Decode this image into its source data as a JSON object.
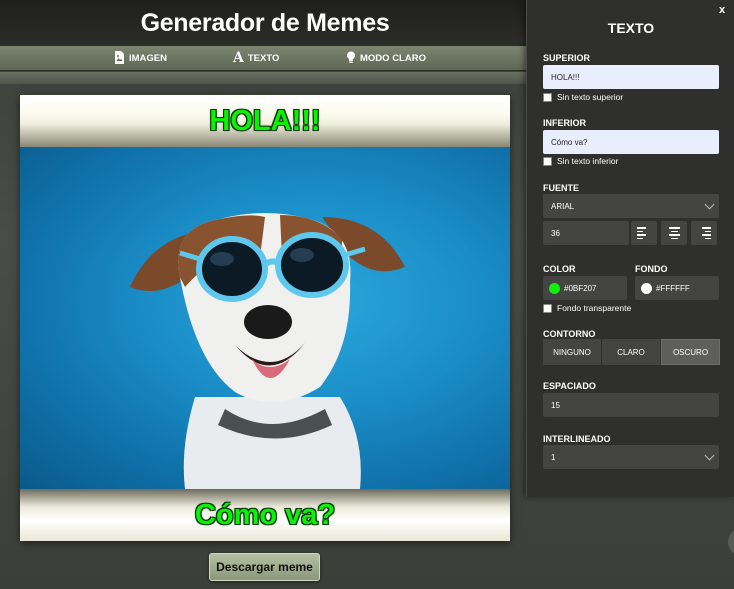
{
  "app": {
    "title": "Generador de Memes"
  },
  "nav": {
    "imagen": {
      "label": "IMAGEN",
      "icon": "image-file-icon"
    },
    "texto": {
      "label": "TEXTO",
      "icon": "text-a-icon"
    },
    "modo": {
      "label": "MODO CLARO",
      "icon": "lightbulb-icon"
    }
  },
  "meme": {
    "top_text": "HOLA!!!",
    "bottom_text": "Cómo va?",
    "text_color": "#0BF207",
    "download_label": "Descargar meme"
  },
  "panel": {
    "title": "TEXTO",
    "close_label": "x",
    "superior": {
      "label": "SUPERIOR",
      "value": "HOLA!!!",
      "checkbox_label": "Sin texto superior"
    },
    "inferior": {
      "label": "INFERIOR",
      "value": "Cómo va?",
      "checkbox_label": "Sin texto inferior"
    },
    "fuente": {
      "label": "FUENTE",
      "value": "ARIAL",
      "size": "36"
    },
    "color": {
      "label": "COLOR",
      "value": "#0BF207",
      "swatch": "#0BF207"
    },
    "fondo": {
      "label": "FONDO",
      "value": "#FFFFFF",
      "swatch": "#FFFFFF",
      "transparent_label": "Fondo transparente"
    },
    "contorno": {
      "label": "CONTORNO",
      "options": [
        "NINGUNO",
        "CLARO",
        "OSCURO"
      ],
      "selected": "OSCURO"
    },
    "espaciado": {
      "label": "ESPACIADO",
      "value": "15"
    },
    "interlineado": {
      "label": "INTERLINEADO",
      "value": "1"
    }
  }
}
